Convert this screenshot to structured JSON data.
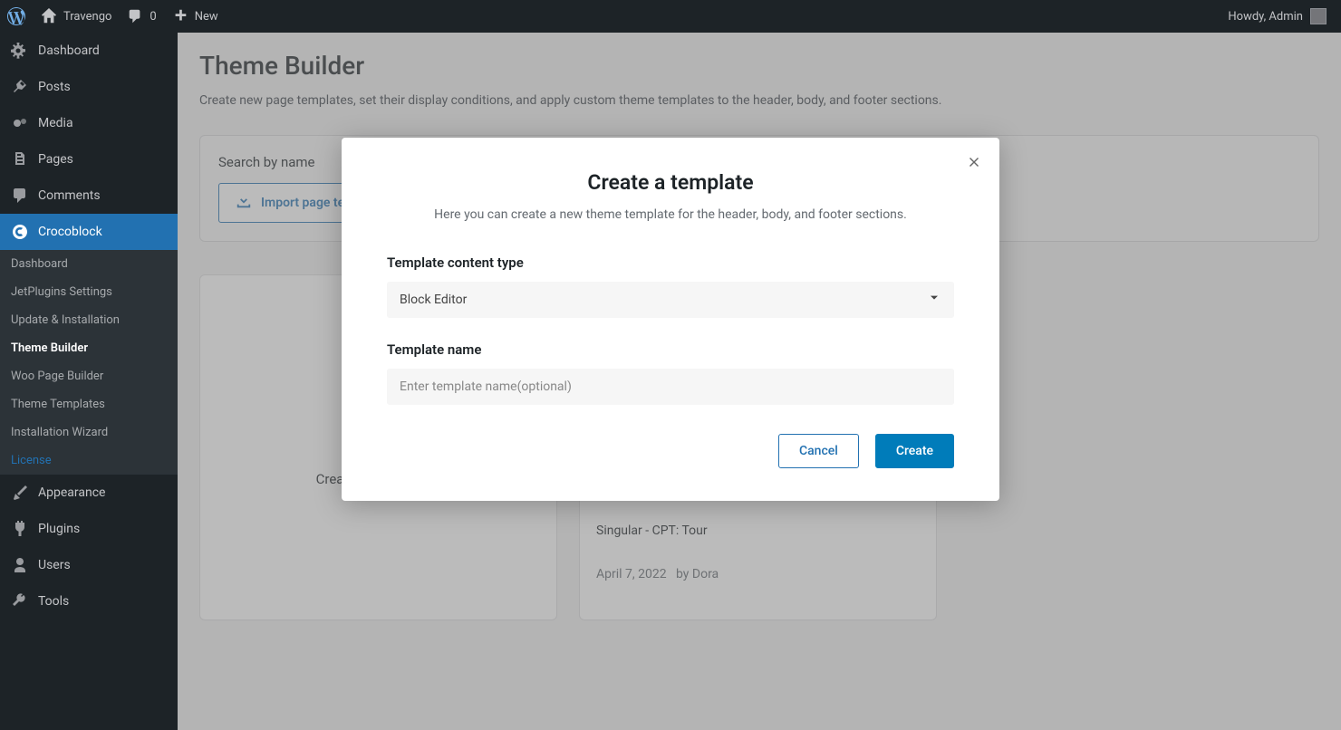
{
  "adminBar": {
    "siteName": "Travengo",
    "commentCount": "0",
    "newLabel": "New",
    "greeting": "Howdy, Admin"
  },
  "sidebar": {
    "items": [
      {
        "label": "Dashboard",
        "icon": "dashboard"
      },
      {
        "label": "Posts",
        "icon": "pin"
      },
      {
        "label": "Media",
        "icon": "media"
      },
      {
        "label": "Pages",
        "icon": "pages"
      },
      {
        "label": "Comments",
        "icon": "comment"
      },
      {
        "label": "Crocoblock",
        "icon": "croco",
        "active": true
      },
      {
        "label": "Appearance",
        "icon": "appearance"
      },
      {
        "label": "Plugins",
        "icon": "plugin"
      },
      {
        "label": "Users",
        "icon": "user"
      },
      {
        "label": "Tools",
        "icon": "tools"
      }
    ],
    "submenu": [
      {
        "label": "Dashboard"
      },
      {
        "label": "JetPlugins Settings"
      },
      {
        "label": "Update & Installation"
      },
      {
        "label": "Theme Builder",
        "current": true
      },
      {
        "label": "Woo Page Builder"
      },
      {
        "label": "Theme Templates"
      },
      {
        "label": "Installation Wizard"
      },
      {
        "label": "License",
        "license": true
      }
    ]
  },
  "page": {
    "title": "Theme Builder",
    "description": "Create new page templates, set their display conditions, and apply custom theme templates to the header, body, and footer sections.",
    "searchLabel": "Search by name",
    "importButton": "Import page template"
  },
  "cards": {
    "create": {
      "label": "Create new template"
    },
    "existing": {
      "tags": "Singular - CPT: Tour",
      "date": "April 7, 2022",
      "author": "by Dora"
    }
  },
  "modal": {
    "title": "Create a template",
    "description": "Here you can create a new theme template for the header, body, and footer sections.",
    "contentTypeLabel": "Template content type",
    "contentTypeValue": "Block Editor",
    "nameLabel": "Template name",
    "namePlaceholder": "Enter template name(optional)",
    "cancel": "Cancel",
    "create": "Create"
  }
}
